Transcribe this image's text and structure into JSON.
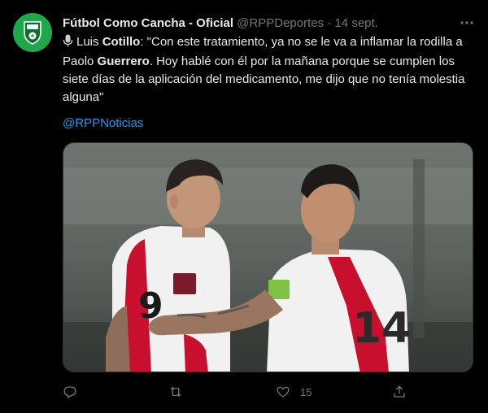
{
  "tweet": {
    "author_name": "Fútbol Como Cancha - Oficial",
    "handle": "@RPPDeportes",
    "separator": "·",
    "date": "14 sept.",
    "more_icon": "more-horizontal-icon",
    "text": {
      "p1": "Luis ",
      "b1": "Cotillo",
      "p2": ": \"Con este tratamiento, ya no se le va a inflamar la rodilla a Paolo ",
      "b2": "Guerrero",
      "p3": ". Hoy hablé con él por la mañana porque se cumplen los siete días de la aplicación del medicamento, me dijo que no tenía molestia alguna\""
    },
    "mention": "@RPPNoticias",
    "media_jersey_number": "14",
    "media_jersey_number_2": "9",
    "actions": {
      "like_count": "15"
    }
  },
  "colors": {
    "background": "#000000",
    "text": "#e7e9ea",
    "secondary": "#71767b",
    "link": "#1d9bf0",
    "avatar": "#1fa84a",
    "jersey_red": "#c8102e"
  },
  "icons": [
    "microphone-icon",
    "reply-icon",
    "retweet-icon",
    "like-icon",
    "share-icon"
  ]
}
